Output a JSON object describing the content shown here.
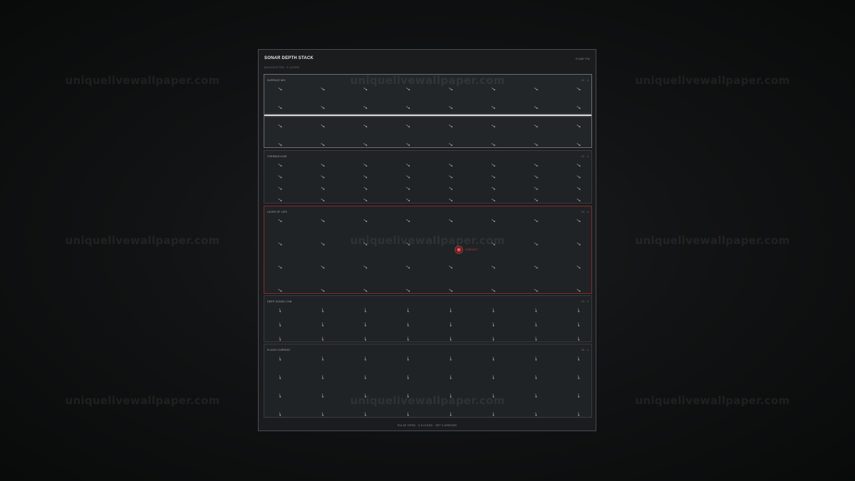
{
  "watermark": "uniquelivewallpaper.com",
  "panel": {
    "title": "SONAR DEPTH STACK",
    "status": "FLOW 77%",
    "subtitle": "BACKSCATTER · 5 LAYERS",
    "footer": "PULSE OPEN · 0.8 CLEAR · SET 3 ARROWS"
  },
  "colors": {
    "arrow": "#aeb2b5",
    "thermocline": "#d9dadb",
    "alert": "#d23a3c",
    "layer_border": "#3a3d40"
  },
  "layers": [
    {
      "label": "SURFACE MIX",
      "meta": "01 · 4",
      "arrow_direction": "down-right",
      "rows": 4,
      "has_thermocline": true,
      "thermocline_fraction": 0.55
    },
    {
      "label": "THERMOCLINE",
      "meta": "02 · 4",
      "arrow_direction": "down-right",
      "rows": 4,
      "has_thermocline": false
    },
    {
      "label": "LAYER OF LIFE",
      "meta": "03 · 4",
      "arrow_direction": "down-right",
      "rows": 4,
      "has_thermocline": false,
      "contact": {
        "label": "CONTACT",
        "col_fraction": 0.59,
        "row_fraction": 0.5
      }
    },
    {
      "label": "DEEP SOUND CHN",
      "meta": "04 · 3",
      "arrow_direction": "down",
      "rows": 3,
      "has_thermocline": false
    },
    {
      "label": "FLOOR CURRENT",
      "meta": "05 · 4",
      "arrow_direction": "down",
      "rows": 4,
      "has_thermocline": false
    }
  ]
}
